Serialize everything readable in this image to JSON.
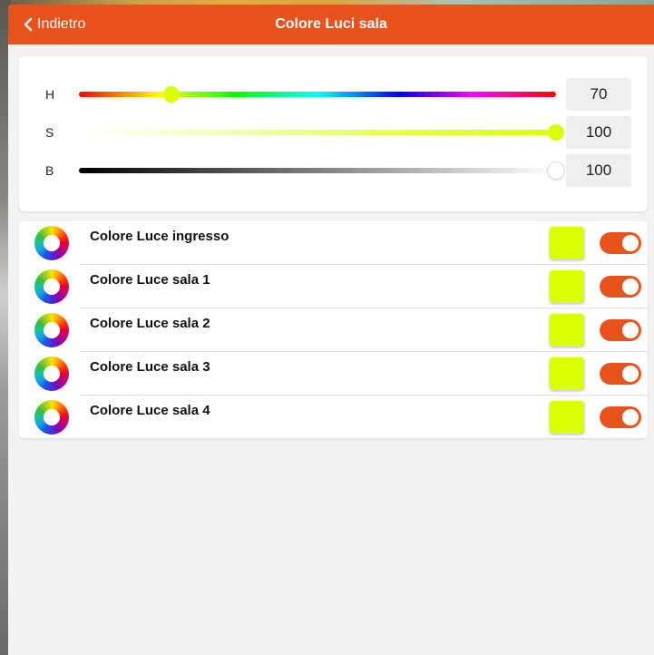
{
  "navbar": {
    "back_label": "Indietro",
    "title": "Colore Luci sala"
  },
  "sliders": [
    {
      "label": "H",
      "value": "70",
      "thumb_fraction": 0.194
    },
    {
      "label": "S",
      "value": "100",
      "thumb_fraction": 1.0
    },
    {
      "label": "B",
      "value": "100",
      "thumb_fraction": 1.0
    }
  ],
  "lights": [
    {
      "label": "Colore Luce ingresso",
      "color": "#d9ff00",
      "enabled": true
    },
    {
      "label": "Colore Luce sala 1",
      "color": "#d9ff00",
      "enabled": true
    },
    {
      "label": "Colore Luce sala 2",
      "color": "#d9ff00",
      "enabled": true
    },
    {
      "label": "Colore Luce sala 3",
      "color": "#d9ff00",
      "enabled": true
    },
    {
      "label": "Colore Luce sala 4",
      "color": "#d9ff00",
      "enabled": true
    }
  ],
  "colors": {
    "accent": "#e8521c",
    "selected_color": "#d9ff00",
    "background": "#f2f2f2"
  }
}
